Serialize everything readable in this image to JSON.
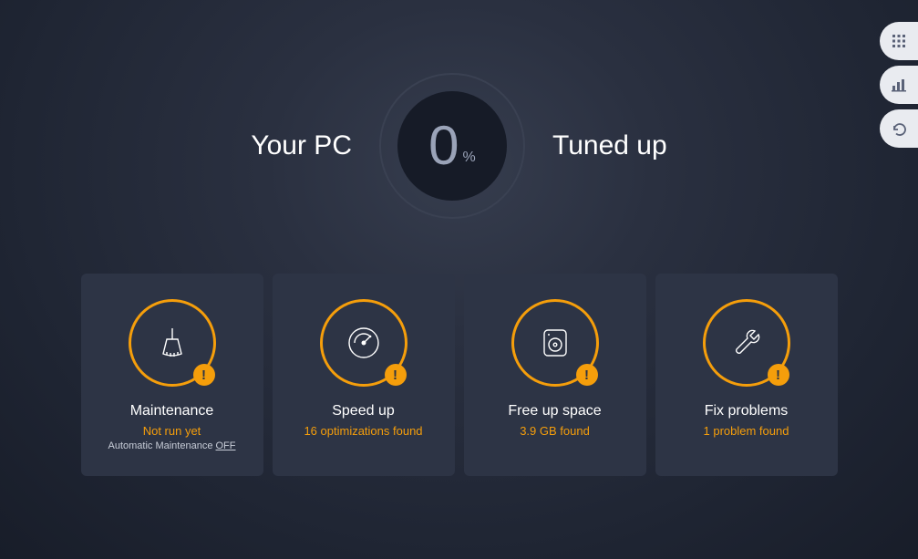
{
  "hero": {
    "left": "Your PC",
    "right": "Tuned up",
    "value": "0",
    "unit": "%"
  },
  "cards": {
    "maintenance": {
      "title": "Maintenance",
      "status": "Not run yet",
      "sub_prefix": "Automatic Maintenance ",
      "sub_state": "OFF"
    },
    "speedup": {
      "title": "Speed up",
      "status": "16 optimizations found"
    },
    "freeup": {
      "title": "Free up space",
      "status": "3.9 GB found"
    },
    "fix": {
      "title": "Fix problems",
      "status": "1 problem found"
    }
  },
  "badge_glyph": "!"
}
